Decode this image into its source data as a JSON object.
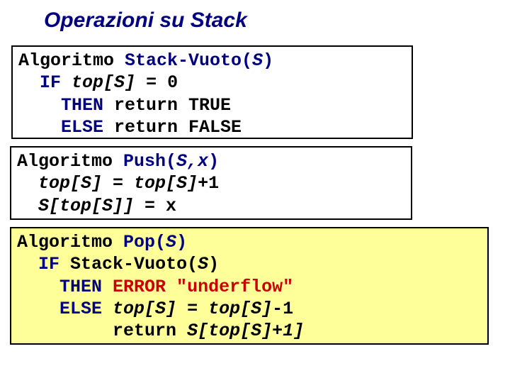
{
  "title": "Operazioni su Stack",
  "box1": {
    "l1_a": "Algoritmo ",
    "l1_b": "Stack-Vuoto(",
    "l1_c": "S",
    "l1_d": ")",
    "l2_a": "  ",
    "l2_b": "IF",
    "l2_c": " top[S] ",
    "l2_d": "= 0",
    "l3_a": "    ",
    "l3_b": "THEN",
    "l3_c": " return TRUE",
    "l4_a": "    ",
    "l4_b": "ELSE",
    "l4_c": " return FALSE"
  },
  "box2": {
    "l1_a": "Algoritmo ",
    "l1_b": "Push(",
    "l1_c": "S,x",
    "l1_d": ")",
    "l2_a": "  ",
    "l2_b": "top[S]",
    "l2_c": " = ",
    "l2_d": "top[S]",
    "l2_e": "+1",
    "l3_a": "  ",
    "l3_b": "S[top[S]]",
    "l3_c": " = x"
  },
  "box3": {
    "l1_a": "Algoritmo ",
    "l1_b": "Pop(",
    "l1_c": "S",
    "l1_d": ")",
    "l2_a": "  ",
    "l2_b": "IF",
    "l2_c": " ",
    "l2_d": "Stack-Vuoto(",
    "l2_e": "S",
    "l2_f": ")",
    "l3_a": "    ",
    "l3_b": "THEN",
    "l3_c": " ",
    "l3_d": "ERROR \"underflow\"",
    "l4_a": "    ",
    "l4_b": "ELSE",
    "l4_c": " top[S]",
    "l4_d": " = ",
    "l4_e": "top[S]",
    "l4_f": "-1",
    "l5_a": "         ",
    "l5_b": "return ",
    "l5_c": "S[top[S]+1]"
  }
}
